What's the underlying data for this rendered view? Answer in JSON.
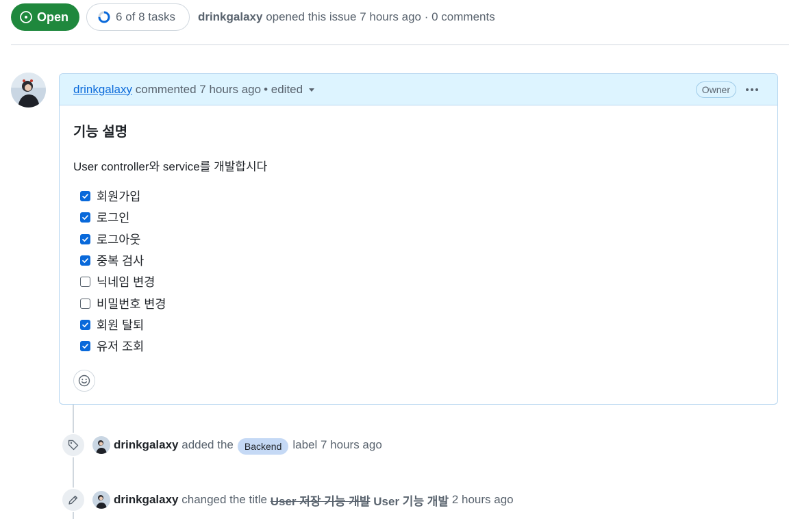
{
  "header": {
    "status_label": "Open",
    "tasks_label": "6 of 8 tasks",
    "tasks_done": 6,
    "tasks_total": 8,
    "author": "drinkgalaxy",
    "meta_text": "opened this issue 7 hours ago · 0 comments"
  },
  "comment": {
    "author": "drinkgalaxy",
    "action_text": "commented 7 hours ago",
    "edited_text": "• edited",
    "role_badge": "Owner",
    "heading": "기능 설명",
    "description": "User controller와 service를 개발합시다",
    "tasks": [
      {
        "label": "회원가입",
        "checked": true
      },
      {
        "label": "로그인",
        "checked": true
      },
      {
        "label": "로그아웃",
        "checked": true
      },
      {
        "label": "중복 검사",
        "checked": true
      },
      {
        "label": "닉네임 변경",
        "checked": false
      },
      {
        "label": "비밀번호 변경",
        "checked": false
      },
      {
        "label": "회원 탈퇴",
        "checked": true
      },
      {
        "label": "유저 조회",
        "checked": true
      }
    ]
  },
  "timeline": [
    {
      "author": "drinkgalaxy",
      "text_before": "added the",
      "label": "Backend",
      "text_after": "label 7 hours ago"
    },
    {
      "author": "drinkgalaxy",
      "text_before": "changed the title",
      "old_title": "User 저장 기능 개발",
      "new_title": "User 기능 개발",
      "text_after": "2 hours ago"
    }
  ],
  "colors": {
    "open_green": "#1f883d",
    "link_blue": "#0969da",
    "header_bg": "#ddf4ff",
    "label_bg": "#c5d9f5"
  }
}
